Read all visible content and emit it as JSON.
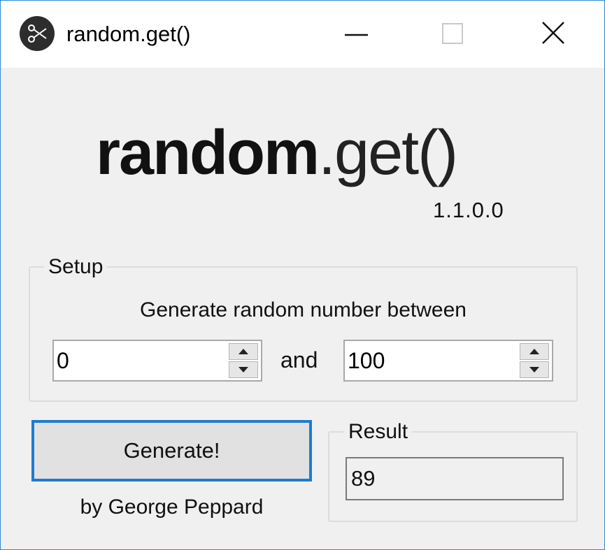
{
  "window": {
    "title": "random.get()",
    "icon": "scissors-icon",
    "controls": [
      "minimize-icon",
      "maximize-icon",
      "close-icon"
    ]
  },
  "logo": {
    "bold": "random",
    "light": ".get()",
    "version": "1.1.0.0"
  },
  "setup": {
    "legend": "Setup",
    "description": "Generate random number between",
    "min_value": "0",
    "separator": "and",
    "max_value": "100"
  },
  "generate": {
    "label": "Generate!",
    "author": "by George Peppard"
  },
  "result": {
    "legend": "Result",
    "value": "89"
  },
  "colors": {
    "accent": "#1e7bd2",
    "window_border": "#2b8ad8",
    "background": "#f0f0f0"
  }
}
